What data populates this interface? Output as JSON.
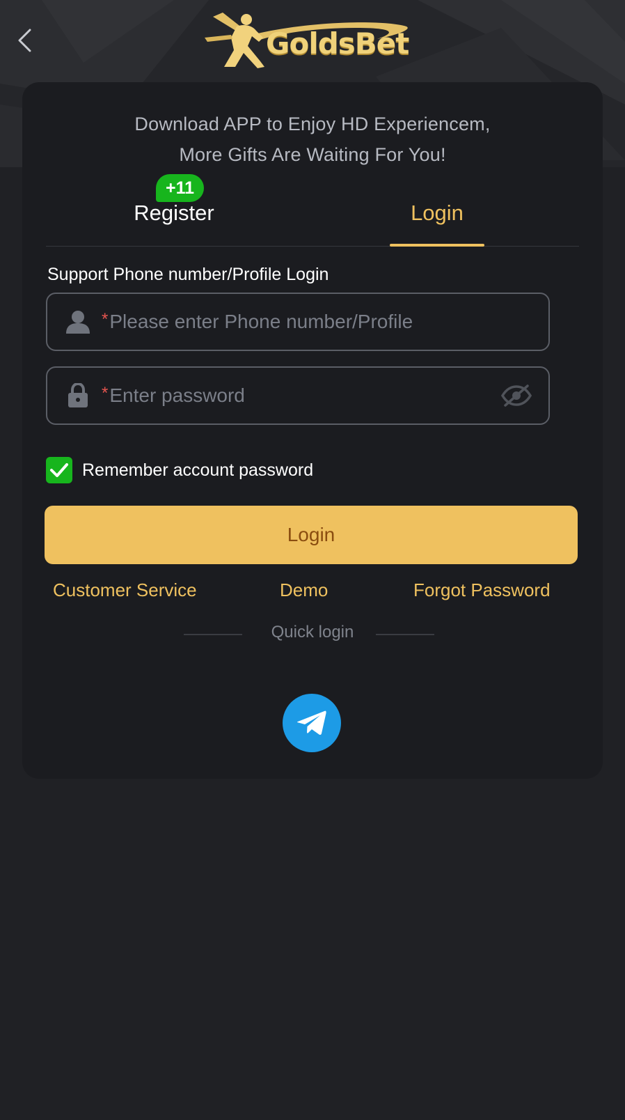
{
  "header": {
    "brand": "GoldsBet"
  },
  "promo": {
    "line1": "Download APP to Enjoy HD Experiencem,",
    "line2": "More Gifts Are Waiting For You!"
  },
  "tabs": {
    "register_label": "Register",
    "register_badge": "+11",
    "login_label": "Login",
    "active": "Login"
  },
  "form": {
    "support_label": "Support Phone number/Profile Login",
    "required_mark": "*",
    "username_placeholder": "Please enter Phone number/Profile",
    "password_placeholder": "Enter password",
    "remember_label": "Remember account password",
    "remember_checked": true,
    "login_button": "Login"
  },
  "links": {
    "customer_service": "Customer Service",
    "demo": "Demo",
    "forgot_password": "Forgot Password"
  },
  "quick_login": {
    "label": "Quick login",
    "providers": [
      "telegram-icon"
    ]
  },
  "colors": {
    "accent": "#efc15f",
    "button_text": "#8a4d10",
    "background": "#202125",
    "card": "#1b1c20",
    "badge_green": "#17b51d",
    "required_red": "#e5554f",
    "telegram_blue": "#1d9be6"
  }
}
